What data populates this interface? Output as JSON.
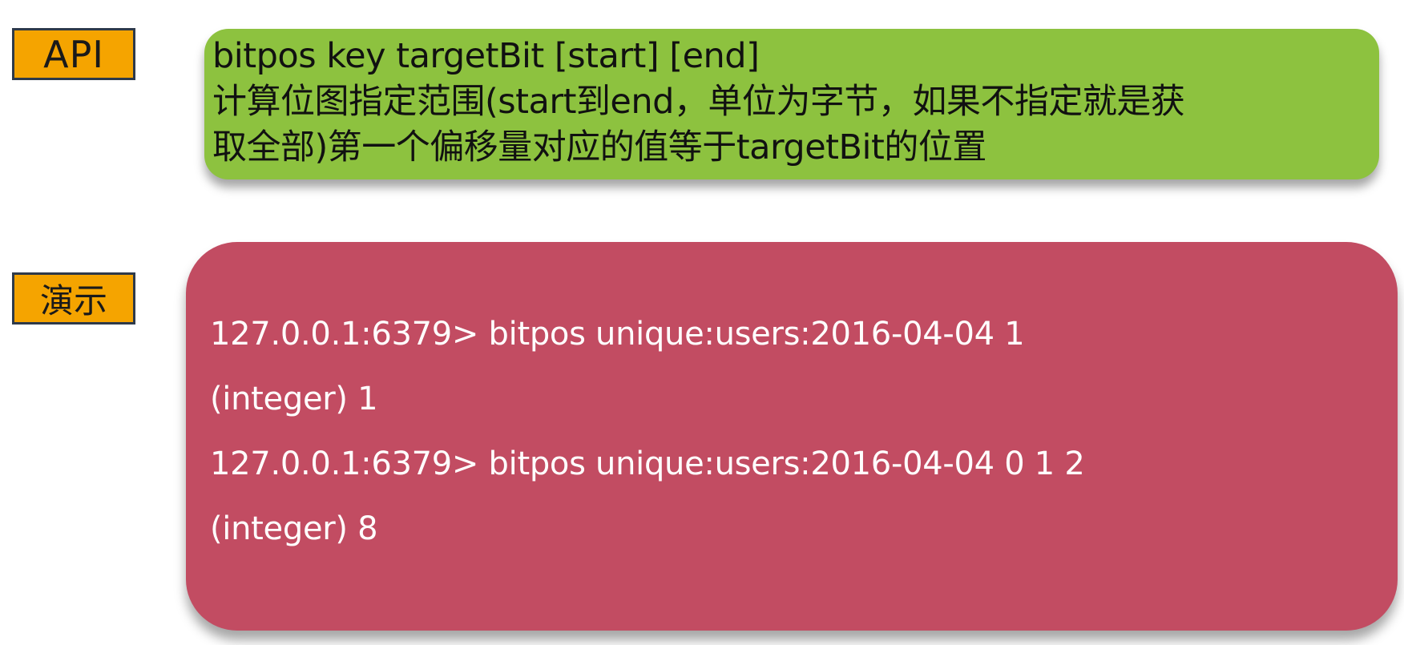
{
  "tags": {
    "api": "API",
    "demo": "演示"
  },
  "api": {
    "lines": [
      "bitpos key targetBit [start] [end]",
      "计算位图指定范围(start到end，单位为字节，如果不指定就是获",
      "取全部)第一个偏移量对应的值等于targetBit的位置"
    ]
  },
  "demo": {
    "lines": [
      "127.0.0.1:6379> bitpos unique:users:2016-04-04 1",
      "(integer) 1",
      "127.0.0.1:6379> bitpos unique:users:2016-04-04 0 1 2",
      "(integer) 8"
    ]
  },
  "colors": {
    "tag_bg": "#f5a400",
    "api_box_bg": "#8dc23f",
    "demo_box_bg": "#c24c62"
  }
}
